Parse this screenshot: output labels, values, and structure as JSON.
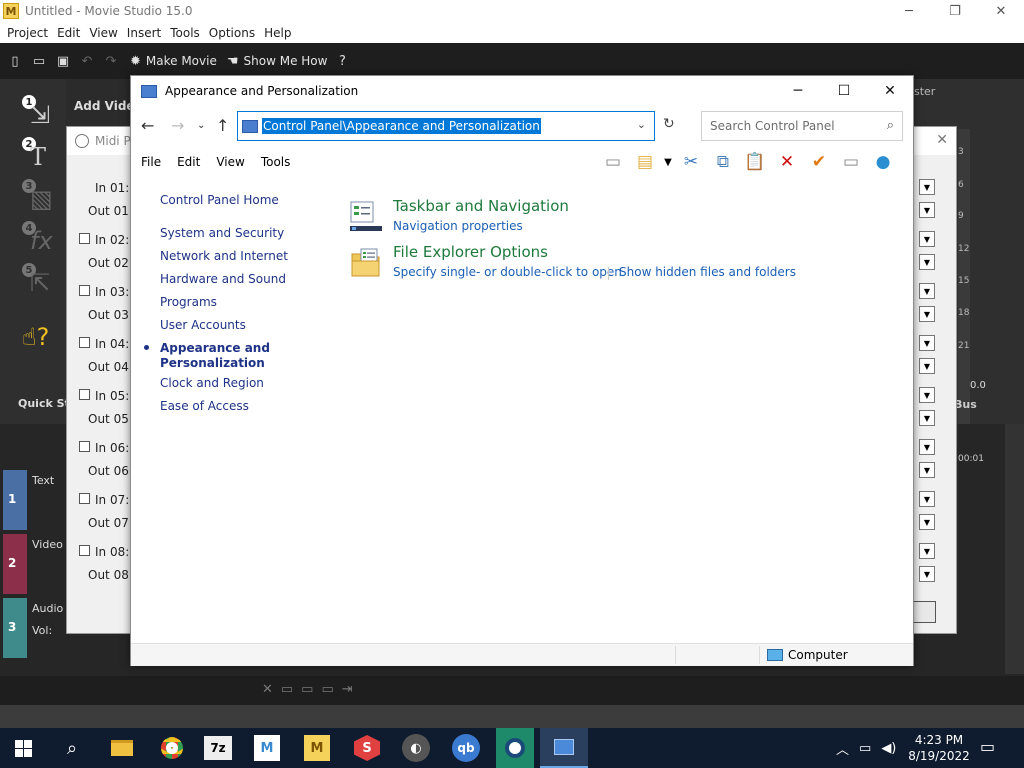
{
  "movie_studio": {
    "title": "Untitled - Movie Studio 15.0",
    "logo_letter": "M",
    "menu": [
      "Project",
      "Edit",
      "View",
      "Insert",
      "Tools",
      "Options",
      "Help"
    ],
    "toolbar": {
      "make_movie": "Make Movie",
      "show_me_how": "Show Me How"
    },
    "add_video": "Add Video",
    "quick_start": "Quick St",
    "master_label": "ster",
    "meter_ticks": [
      "3",
      "6",
      "9",
      "12",
      "15",
      "18",
      "21"
    ],
    "meter_value": "0.0",
    "bus_label": "Bus",
    "timecode": "00:01",
    "tracks": [
      {
        "number": "1",
        "label": "Text",
        "color": "#4a6fa5"
      },
      {
        "number": "2",
        "label": "Video",
        "color": "#8b2f4a"
      },
      {
        "number": "3",
        "label": "Audio",
        "color": "#3f8b8b"
      }
    ],
    "vol_label": "Vol:"
  },
  "midi_dialog": {
    "title": "Midi P",
    "rows": [
      {
        "in": "In 01:",
        "out": "Out 01:"
      },
      {
        "in": "In 02:",
        "out": "Out 02:"
      },
      {
        "in": "In 03:",
        "out": "Out 03:"
      },
      {
        "in": "In 04:",
        "out": "Out 04:"
      },
      {
        "in": "In 05:",
        "out": "Out 05:"
      },
      {
        "in": "In 06:",
        "out": "Out 06:"
      },
      {
        "in": "In 07:",
        "out": "Out 07:"
      },
      {
        "in": "In 08:",
        "out": "Out 08:"
      }
    ]
  },
  "control_panel": {
    "title": "Appearance and Personalization",
    "address": "Control Panel\\Appearance and Personalization",
    "search_placeholder": "Search Control Panel",
    "menu": [
      "File",
      "Edit",
      "View",
      "Tools"
    ],
    "sidebar": [
      {
        "label": "Control Panel Home"
      },
      {
        "label": "System and Security"
      },
      {
        "label": "Network and Internet"
      },
      {
        "label": "Hardware and Sound"
      },
      {
        "label": "Programs"
      },
      {
        "label": "User Accounts"
      },
      {
        "label": "Appearance and Personalization"
      },
      {
        "label": "Clock and Region"
      },
      {
        "label": "Ease of Access"
      }
    ],
    "categories": [
      {
        "title": "Taskbar and Navigation",
        "links": [
          "Navigation properties"
        ]
      },
      {
        "title": "File Explorer Options",
        "links": [
          "Specify single- or double-click to open",
          "Show hidden files and folders"
        ]
      }
    ],
    "status_computer": "Computer"
  },
  "taskbar": {
    "time": "4:23 PM",
    "date": "8/19/2022"
  }
}
